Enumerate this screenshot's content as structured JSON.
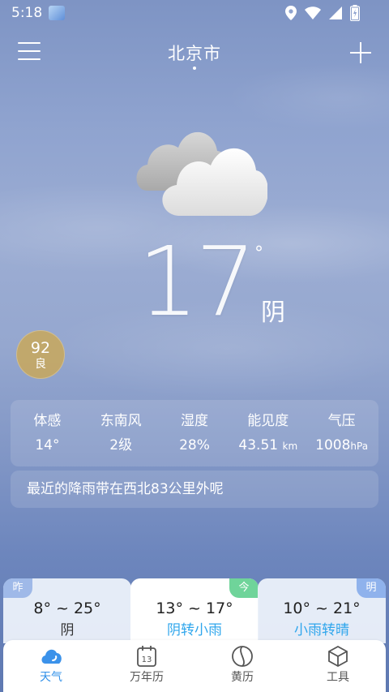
{
  "status_bar": {
    "time": "5:18"
  },
  "header": {
    "city": "北京市"
  },
  "current": {
    "temperature": "17",
    "degree_symbol": "°",
    "condition": "阴"
  },
  "aqi": {
    "value": "92",
    "level": "良"
  },
  "details": [
    {
      "label": "体感",
      "value": "14°",
      "unit": ""
    },
    {
      "label": "东南风",
      "value": "2级",
      "unit": ""
    },
    {
      "label": "湿度",
      "value": "28%",
      "unit": ""
    },
    {
      "label": "能见度",
      "value": "43.51",
      "unit": "km"
    },
    {
      "label": "气压",
      "value": "1008",
      "unit": "hPa"
    }
  ],
  "rain_tip": "最近的降雨带在西北83公里外呢",
  "forecast": [
    {
      "tag": "昨",
      "range": "8° ~ 25°",
      "condition": "阴"
    },
    {
      "tag": "今",
      "range": "13° ~ 17°",
      "condition": "阴转小雨"
    },
    {
      "tag": "明",
      "range": "10° ~ 21°",
      "condition": "小雨转晴"
    }
  ],
  "calendar_icon_day": "13",
  "nav": [
    {
      "label": "天气",
      "icon": "weather-cloud-icon"
    },
    {
      "label": "万年历",
      "icon": "calendar-icon"
    },
    {
      "label": "黄历",
      "icon": "almanac-icon"
    },
    {
      "label": "工具",
      "icon": "tools-icon"
    }
  ],
  "colors": {
    "accent": "#2f8fe8",
    "aqi_good": "#c9a85a",
    "today_tag": "#6fd49a",
    "forecast_link": "#2fa6ec"
  }
}
